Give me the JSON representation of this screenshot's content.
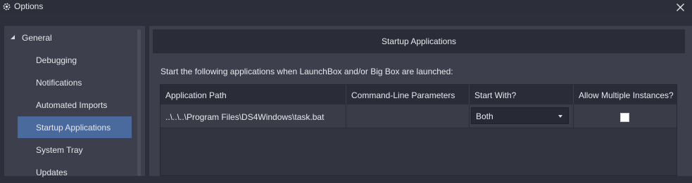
{
  "window": {
    "title": "Options",
    "icon": "gear-icon",
    "close_icon": "close-icon"
  },
  "sidebar": {
    "group_label": "General",
    "items": [
      {
        "label": "Debugging"
      },
      {
        "label": "Notifications"
      },
      {
        "label": "Automated Imports"
      },
      {
        "label": "Startup Applications",
        "selected": true
      },
      {
        "label": "System Tray"
      },
      {
        "label": "Updates"
      }
    ]
  },
  "main": {
    "header": "Startup Applications",
    "description": "Start the following applications when LaunchBox and/or Big Box are launched:",
    "columns": [
      "Application Path",
      "Command-Line Parameters",
      "Start With?",
      "Allow Multiple Instances?"
    ],
    "rows": [
      {
        "path": "..\\..\\..\\Program Files\\DS4Windows\\task.bat",
        "params": "",
        "start_with": "Both",
        "allow_multiple": false
      }
    ]
  },
  "colors": {
    "selected": "#4a6a9d",
    "panel": "#3d3f4c",
    "header": "#2a2c37"
  }
}
